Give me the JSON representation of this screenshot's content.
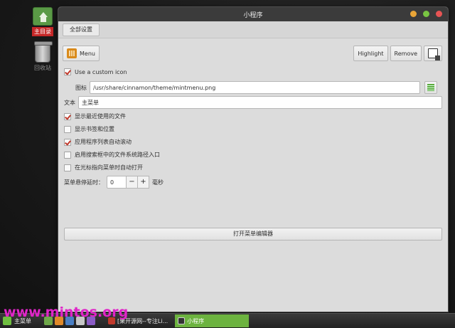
{
  "desktop": {
    "home_label": "主目录",
    "trash_label": "回收站"
  },
  "window": {
    "title": "小程序",
    "tab_all_settings": "全部设置",
    "menu_button": "Menu",
    "highlight_button": "Highlight",
    "remove_button": "Remove",
    "use_custom_icon": "Use a custom icon",
    "use_custom_icon_checked": true,
    "icon_label": "图标",
    "icon_path": "/usr/share/cinnamon/theme/mintmenu.png",
    "text_label": "文本",
    "text_value": "主菜单",
    "options": [
      {
        "label": "显示最近使用的文件",
        "checked": true
      },
      {
        "label": "显示书签和位置",
        "checked": false
      },
      {
        "label": "应用程序列表自动滚动",
        "checked": true
      },
      {
        "label": "启用搜索框中的文件系统路径入口",
        "checked": false
      },
      {
        "label": "在光标指向菜单时自动打开",
        "checked": false
      }
    ],
    "hover_delay_label": "菜单悬停延时：",
    "hover_delay_value": "0",
    "hover_delay_unit": "毫秒",
    "spin_minus": "−",
    "spin_plus": "+",
    "open_editor_button": "打开菜单编辑器"
  },
  "taskbar": {
    "start_label": "主菜单",
    "task_browser": "[果",
    "task_browser_2": "开源网--专注Li...",
    "task_active": "小程序"
  },
  "watermark": "www.mintos.org",
  "colors": {
    "check_red": "#c0392b",
    "active_task": "#6cb33f",
    "watermark": "#e024c8"
  }
}
